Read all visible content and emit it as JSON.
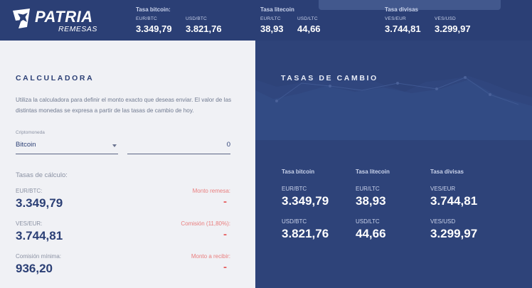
{
  "header": {
    "brand": "PATRIA",
    "brand_sub": "REMESAS",
    "groups": [
      {
        "title": "Tasa bitcoin:",
        "pairs": [
          {
            "label": "EUR/BTC",
            "value": "3.349,79"
          },
          {
            "label": "USD/BTC",
            "value": "3.821,76"
          }
        ]
      },
      {
        "title": "Tasa litecoin",
        "pairs": [
          {
            "label": "EUR/LTC",
            "value": "38,93"
          },
          {
            "label": "USD/LTC",
            "value": "44,66"
          }
        ]
      },
      {
        "title": "Tasa divisas",
        "pairs": [
          {
            "label": "VES/EUR",
            "value": "3.744,81"
          },
          {
            "label": "VES/USD",
            "value": "3.299,97"
          }
        ]
      }
    ]
  },
  "calculator": {
    "title": "CALCULADORA",
    "description": "Utiliza la calculadora para definir el monto exacto que deseas enviar. El valor de las distintas monedas se expresa a partir de las tasas de cambio de hoy.",
    "crypto_label": "Criptomoneda",
    "crypto_selected": "Bitcoin",
    "amount_value": "0",
    "rates_title": "Tasas de cálculo:",
    "rates": [
      {
        "label": "EUR/BTC:",
        "value": "3.349,79"
      },
      {
        "label": "VES/EUR:",
        "value": "3.744,81"
      },
      {
        "label": "Comisión mínima:",
        "value": "936,20"
      }
    ],
    "results": [
      {
        "label": "Monto remesa:",
        "value": "-"
      },
      {
        "label": "Comisión (11,80%):",
        "value": "-"
      },
      {
        "label": "Monto a recibir:",
        "value": "-"
      }
    ]
  },
  "exchange": {
    "title": "TASAS DE CAMBIO",
    "groups": [
      {
        "title": "Tasa bitcoin",
        "pairs": [
          {
            "label": "EUR/BTC",
            "value": "3.349,79"
          },
          {
            "label": "USD/BTC",
            "value": "3.821,76"
          }
        ]
      },
      {
        "title": "Tasa litecoin",
        "pairs": [
          {
            "label": "EUR/LTC",
            "value": "38,93"
          },
          {
            "label": "USD/LTC",
            "value": "44,66"
          }
        ]
      },
      {
        "title": "Tasa divisas",
        "pairs": [
          {
            "label": "VES/EUR",
            "value": "3.744,81"
          },
          {
            "label": "VES/USD",
            "value": "3.299,97"
          }
        ]
      }
    ]
  },
  "colors": {
    "primary": "#2b3f75",
    "panel": "#2e4379",
    "accent_red": "#e55a5a",
    "light_bg": "#f0f1f5"
  }
}
